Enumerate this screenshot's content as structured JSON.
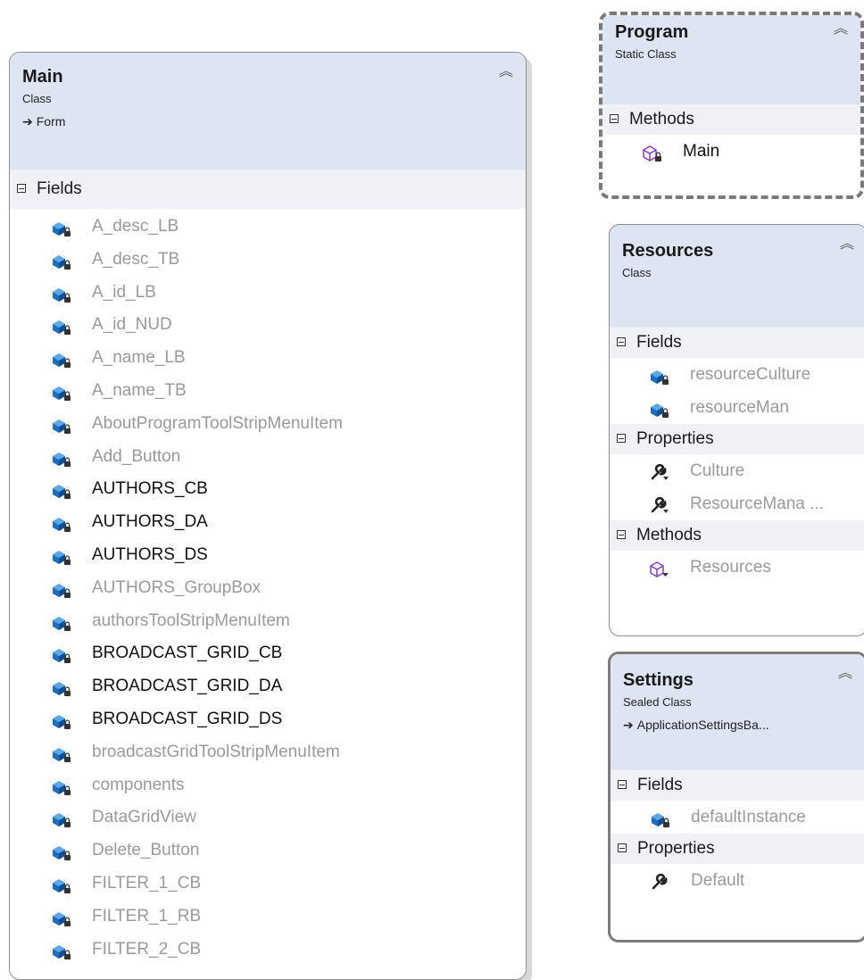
{
  "main": {
    "title": "Main",
    "stereotype": "Class",
    "base": "Form",
    "sections": [
      {
        "label": "Fields",
        "items": [
          {
            "name": "A_desc_LB",
            "access": "private"
          },
          {
            "name": "A_desc_TB",
            "access": "private"
          },
          {
            "name": "A_id_LB",
            "access": "private"
          },
          {
            "name": "A_id_NUD",
            "access": "private"
          },
          {
            "name": "A_name_LB",
            "access": "private"
          },
          {
            "name": "A_name_TB",
            "access": "private"
          },
          {
            "name": "AboutProgramToolStripMenuItem",
            "access": "private"
          },
          {
            "name": "Add_Button",
            "access": "private"
          },
          {
            "name": "AUTHORS_CB",
            "access": "public"
          },
          {
            "name": "AUTHORS_DA",
            "access": "public"
          },
          {
            "name": "AUTHORS_DS",
            "access": "public"
          },
          {
            "name": "AUTHORS_GroupBox",
            "access": "private"
          },
          {
            "name": "authorsToolStripMenuItem",
            "access": "private"
          },
          {
            "name": "BROADCAST_GRID_CB",
            "access": "public"
          },
          {
            "name": "BROADCAST_GRID_DA",
            "access": "public"
          },
          {
            "name": "BROADCAST_GRID_DS",
            "access": "public"
          },
          {
            "name": "broadcastGridToolStripMenuItem",
            "access": "private"
          },
          {
            "name": "components",
            "access": "private"
          },
          {
            "name": "DataGridView",
            "access": "private"
          },
          {
            "name": "Delete_Button",
            "access": "private"
          },
          {
            "name": "FILTER_1_CB",
            "access": "private"
          },
          {
            "name": "FILTER_1_RB",
            "access": "private"
          },
          {
            "name": "FILTER_2_CB",
            "access": "private"
          }
        ]
      }
    ]
  },
  "program": {
    "title": "Program",
    "stereotype": "Static Class",
    "base": "",
    "sections": [
      {
        "label": "Methods",
        "items": [
          {
            "name": "Main",
            "access": "public",
            "kind": "method"
          }
        ]
      }
    ]
  },
  "resources": {
    "title": "Resources",
    "stereotype": "Class",
    "base": "",
    "sections": [
      {
        "label": "Fields",
        "items": [
          {
            "name": "resourceCulture",
            "access": "private",
            "kind": "field"
          },
          {
            "name": "resourceMan",
            "access": "private",
            "kind": "field"
          }
        ]
      },
      {
        "label": "Properties",
        "items": [
          {
            "name": "Culture",
            "access": "internal",
            "kind": "property"
          },
          {
            "name": "ResourceMana ...",
            "access": "internal",
            "kind": "property"
          }
        ]
      },
      {
        "label": "Methods",
        "items": [
          {
            "name": "Resources",
            "access": "internal",
            "kind": "method"
          }
        ]
      }
    ]
  },
  "settings": {
    "title": "Settings",
    "stereotype": "Sealed Class",
    "base": "ApplicationSettingsBa...",
    "sections": [
      {
        "label": "Fields",
        "items": [
          {
            "name": "defaultInstance",
            "access": "private",
            "kind": "field"
          }
        ]
      },
      {
        "label": "Properties",
        "items": [
          {
            "name": "Default",
            "access": "public",
            "kind": "property"
          }
        ]
      }
    ]
  },
  "icons": {
    "collapse": "double-chevron-up-icon",
    "inherits": "arrow-right-icon",
    "expander": "minus-box-icon",
    "field": "field-cube-icon",
    "method": "method-cube-icon",
    "property": "wrench-icon"
  },
  "colors": {
    "header_bg": "#dde4f2",
    "section_bg": "#eff1f7",
    "field_icon": "#1c6fbf",
    "method_icon": "#8a3cc4"
  }
}
